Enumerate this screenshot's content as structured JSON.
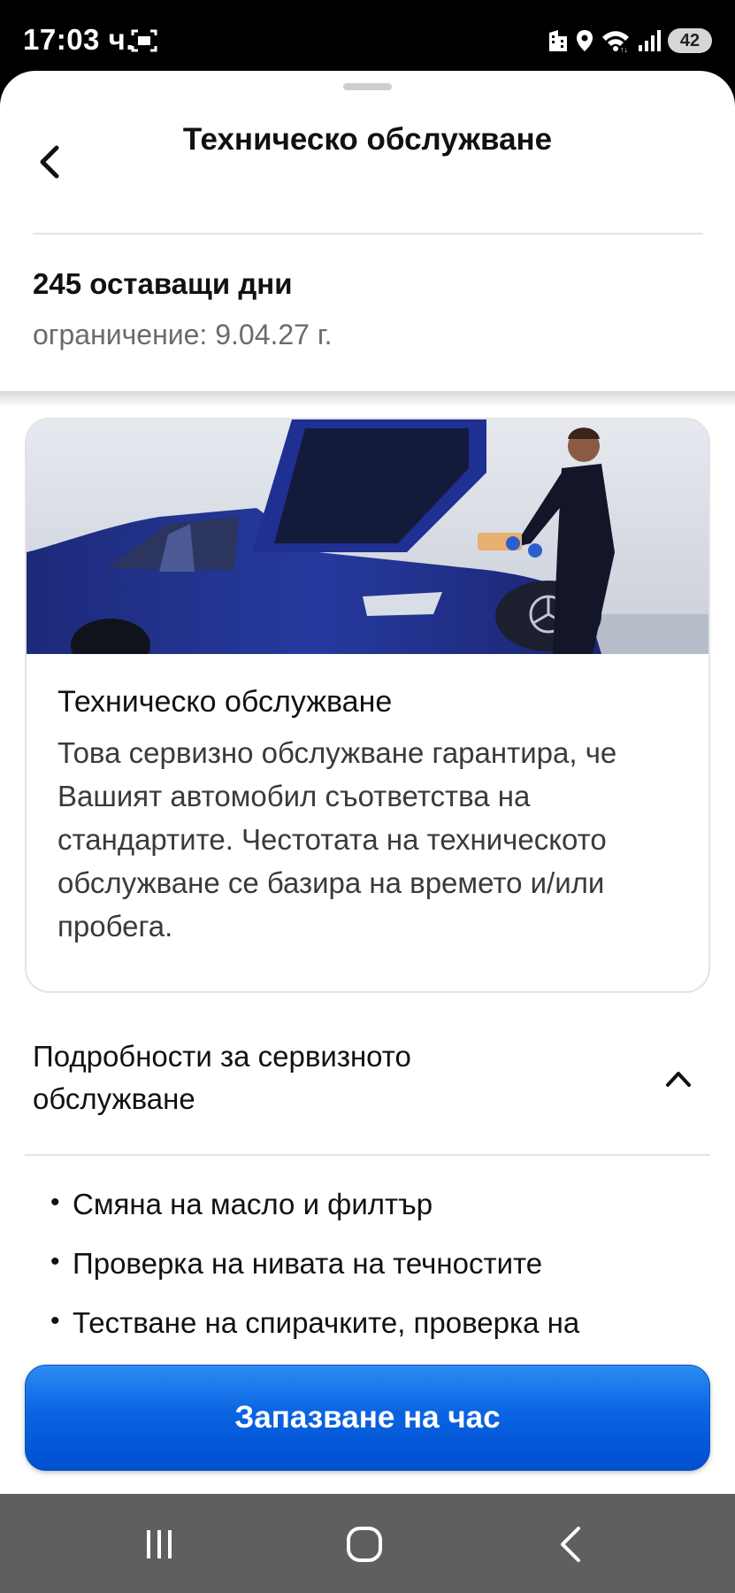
{
  "status_bar": {
    "time": "17:03 ч.",
    "battery": "42",
    "icons": [
      "screenshot-icon",
      "building-icon",
      "location-icon",
      "wifi-icon",
      "signal-icon",
      "battery-icon"
    ]
  },
  "header": {
    "title": "Техническо обслужване",
    "back_icon": "chevron-left-icon"
  },
  "summary": {
    "remaining": "245 оставащи дни",
    "limit": "ограничение: 9.04.27 г."
  },
  "card": {
    "image_alt": "Technician replacing an air filter on a blue car",
    "title": "Техническо обслужване",
    "description": "Това сервизно обслужване гарантира, че Вашият автомобил съответства на стандартите. Честотата на техническото обслужване се базира на времето и/или пробега."
  },
  "details": {
    "title": "Подробности за сервизното обслужване",
    "expanded": true,
    "items": [
      "Смяна на масло и филтър",
      "Проверка на нивата на течностите",
      "Тестване на спирачките, проверка на"
    ]
  },
  "cta": {
    "label": "Запазване на час"
  },
  "nav_bar": {
    "buttons": [
      "recent-apps-icon",
      "home-icon",
      "back-icon"
    ]
  },
  "colors": {
    "accent": "#0a64e2",
    "text": "#111111",
    "muted": "#6b6b6b"
  }
}
